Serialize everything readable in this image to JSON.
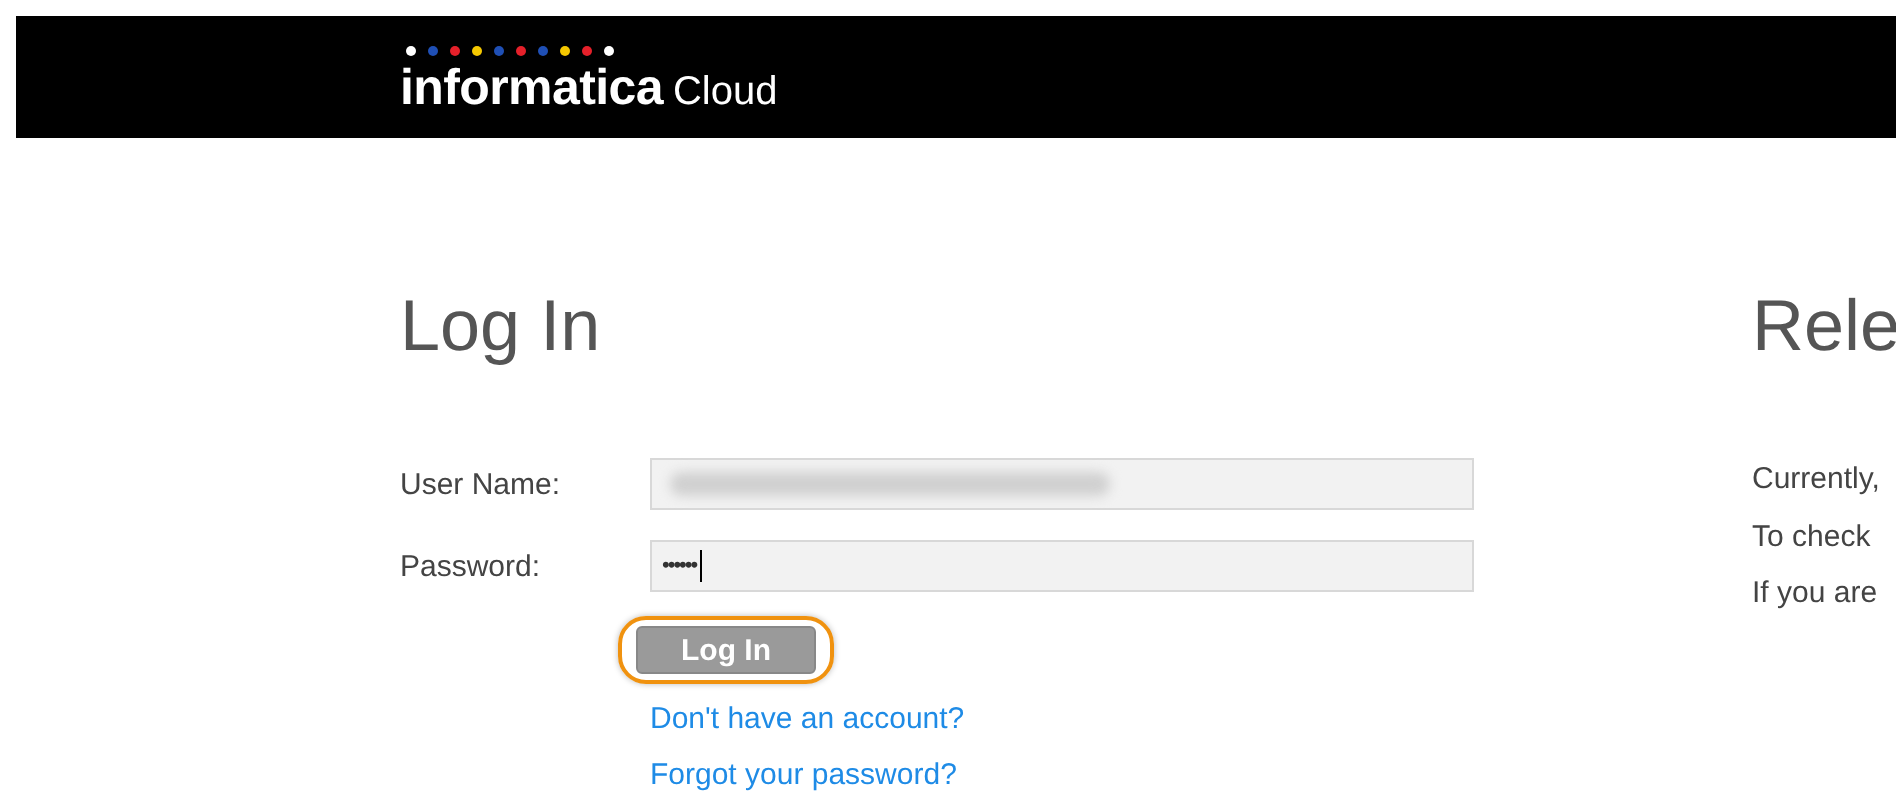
{
  "header": {
    "logo": {
      "dots": [
        {
          "color": "#ffffff"
        },
        {
          "color": "#1f4fb5"
        },
        {
          "color": "#e5202a"
        },
        {
          "color": "#f5c800"
        },
        {
          "color": "#1f4fb5"
        },
        {
          "color": "#e5202a"
        },
        {
          "color": "#1f4fb5"
        },
        {
          "color": "#f5c800"
        },
        {
          "color": "#e5202a"
        },
        {
          "color": "#ffffff"
        }
      ],
      "wordmark": "informatica",
      "product": "Cloud"
    }
  },
  "login": {
    "title": "Log In",
    "fields": [
      {
        "label": "User Name:",
        "redacted": true,
        "focused": false
      },
      {
        "label": "Password:",
        "value": "••••••",
        "focused": true
      }
    ],
    "button": {
      "label": "Log In",
      "focused": true
    },
    "links": [
      "Don't have an account?",
      "Forgot your password?"
    ]
  },
  "release": {
    "title": "Rele",
    "lines": [
      "Currently,",
      "To check",
      "If you are"
    ]
  }
}
